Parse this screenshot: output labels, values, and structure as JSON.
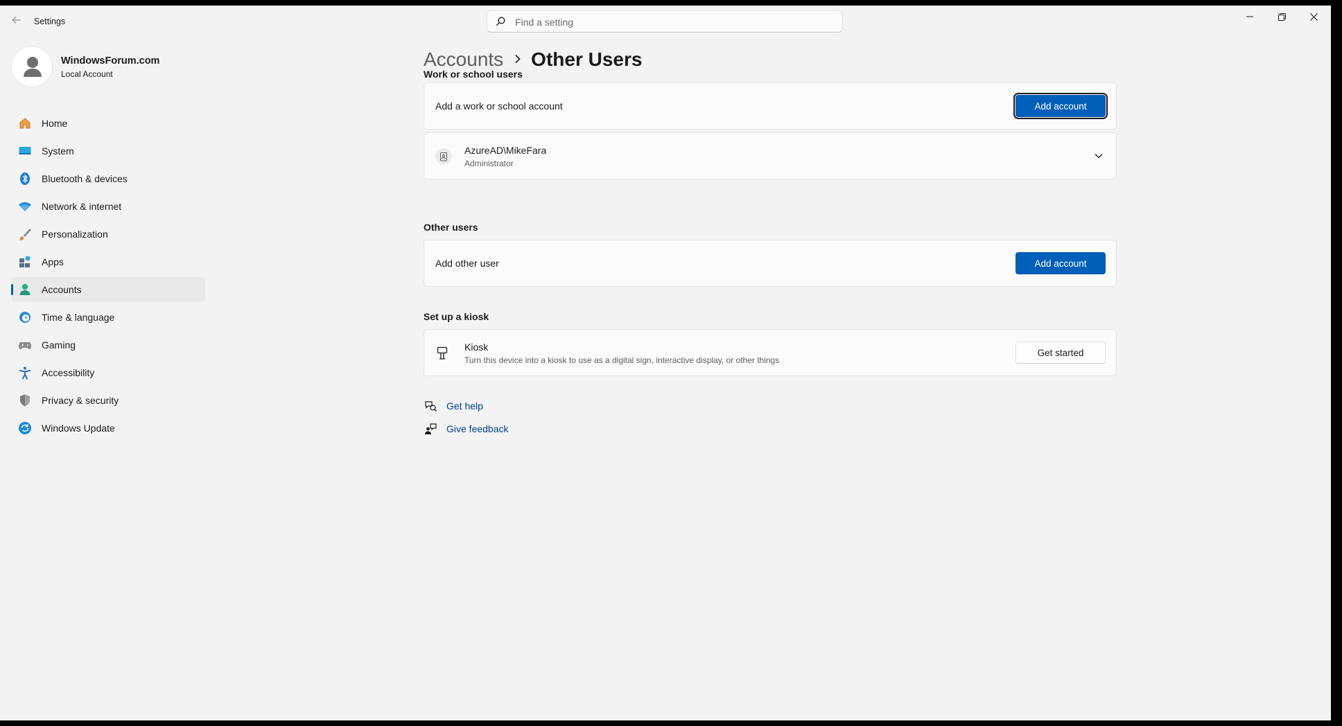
{
  "window": {
    "app_title": "Settings",
    "search_placeholder": "Find a setting"
  },
  "profile": {
    "name": "WindowsForum.com",
    "account_type": "Local Account"
  },
  "sidebar": {
    "items": [
      {
        "label": "Home",
        "icon": "home-icon"
      },
      {
        "label": "System",
        "icon": "system-icon"
      },
      {
        "label": "Bluetooth & devices",
        "icon": "bluetooth-icon"
      },
      {
        "label": "Network & internet",
        "icon": "wifi-icon"
      },
      {
        "label": "Personalization",
        "icon": "brush-icon"
      },
      {
        "label": "Apps",
        "icon": "apps-icon"
      },
      {
        "label": "Accounts",
        "icon": "accounts-icon",
        "active": true
      },
      {
        "label": "Time & language",
        "icon": "globe-clock-icon"
      },
      {
        "label": "Gaming",
        "icon": "gamepad-icon"
      },
      {
        "label": "Accessibility",
        "icon": "accessibility-icon"
      },
      {
        "label": "Privacy & security",
        "icon": "shield-icon"
      },
      {
        "label": "Windows Update",
        "icon": "update-icon"
      }
    ]
  },
  "breadcrumb": {
    "parent": "Accounts",
    "current": "Other Users"
  },
  "work_school": {
    "title": "Work or school users",
    "add_label": "Add a work or school account",
    "add_button": "Add account",
    "user": {
      "name": "AzureAD\\MikeFara",
      "role": "Administrator"
    }
  },
  "other_users": {
    "title": "Other users",
    "add_label": "Add other user",
    "add_button": "Add account"
  },
  "kiosk": {
    "title": "Set up a kiosk",
    "item_title": "Kiosk",
    "item_desc": "Turn this device into a kiosk to use as a digital sign, interactive display, or other things",
    "button": "Get started"
  },
  "help": {
    "get_help": "Get help",
    "give_feedback": "Give feedback"
  },
  "colors": {
    "accent": "#005fb8",
    "background": "#f3f3f3",
    "card": "#fbfbfb",
    "link": "#003e92"
  }
}
